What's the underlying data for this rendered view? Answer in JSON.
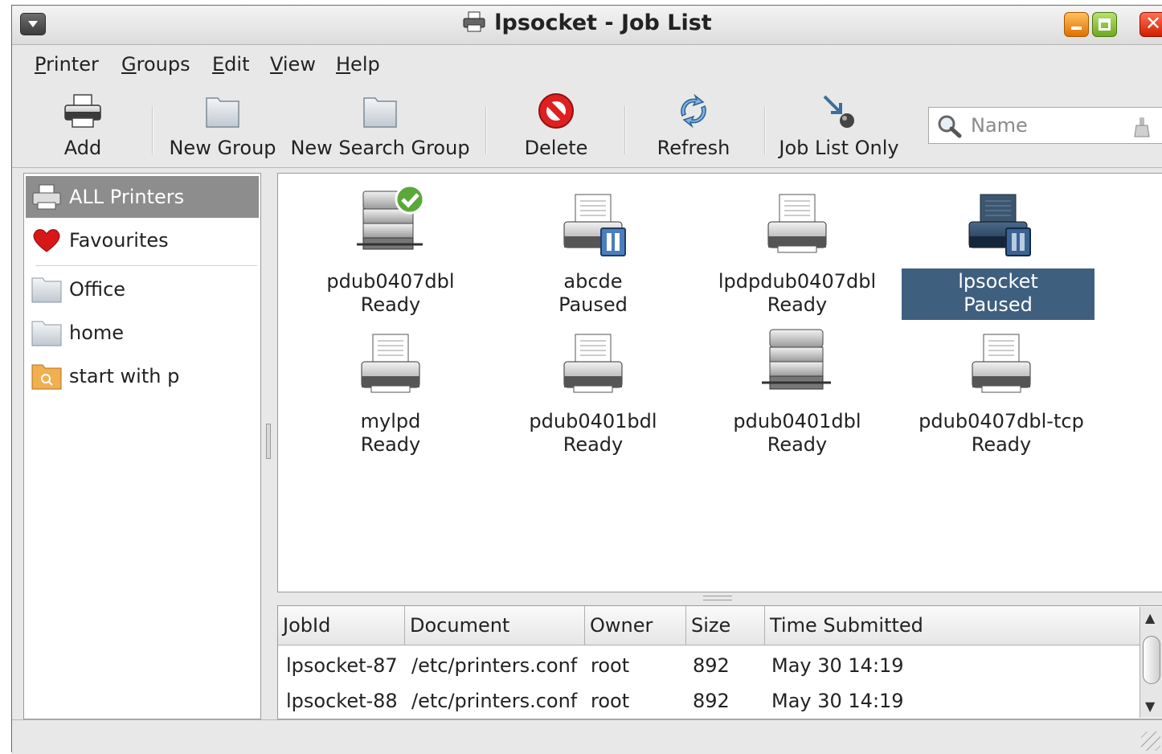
{
  "window": {
    "title": "lpsocket - Job List"
  },
  "menubar": [
    {
      "pre": "",
      "ul": "P",
      "post": "rinter"
    },
    {
      "pre": "",
      "ul": "G",
      "post": "roups"
    },
    {
      "pre": "",
      "ul": "E",
      "post": "dit"
    },
    {
      "pre": "",
      "ul": "V",
      "post": "iew"
    },
    {
      "pre": "",
      "ul": "H",
      "post": "elp"
    }
  ],
  "toolbar": {
    "add": "Add",
    "new_group": "New Group",
    "new_search_group": "New Search Group",
    "delete": "Delete",
    "refresh": "Refresh",
    "job_list_only": "Job List Only",
    "search_placeholder": "Name"
  },
  "sidebar": {
    "items": [
      {
        "label": "ALL Printers",
        "icon": "printer-icon",
        "selected": true
      },
      {
        "label": "Favourites",
        "icon": "heart-icon"
      },
      {
        "label": "Office",
        "icon": "folder-icon"
      },
      {
        "label": "home",
        "icon": "folder-icon"
      },
      {
        "label": "start with p",
        "icon": "search-folder-icon"
      }
    ]
  },
  "printers": [
    {
      "name": "pdub0407dbl",
      "status": "Ready",
      "icon": "printer-server-default-icon"
    },
    {
      "name": "abcde",
      "status": "Paused",
      "icon": "printer-paused-icon"
    },
    {
      "name": "lpdpdub0407dbl",
      "status": "Ready",
      "icon": "printer-icon"
    },
    {
      "name": "lpsocket",
      "status": "Paused",
      "icon": "printer-paused-icon",
      "selected": true
    },
    {
      "name": "mylpd",
      "status": "Ready",
      "icon": "printer-icon"
    },
    {
      "name": "pdub0401bdl",
      "status": "Ready",
      "icon": "printer-icon"
    },
    {
      "name": "pdub0401dbl",
      "status": "Ready",
      "icon": "printer-server-icon"
    },
    {
      "name": "pdub0407dbl-tcp",
      "status": "Ready",
      "icon": "printer-icon"
    }
  ],
  "jobs": {
    "columns": [
      "JobId",
      "Document",
      "Owner",
      "Size",
      "Time Submitted"
    ],
    "rows": [
      [
        "lpsocket-87",
        "/etc/printers.conf",
        "root",
        "892",
        "May 30 14:19"
      ],
      [
        "lpsocket-88",
        "/etc/printers.conf",
        "root",
        "892",
        "May 30 14:19"
      ]
    ]
  },
  "colors": {
    "selection": "#3f5f7f",
    "sidebar_selection": "#8d8d8d"
  }
}
